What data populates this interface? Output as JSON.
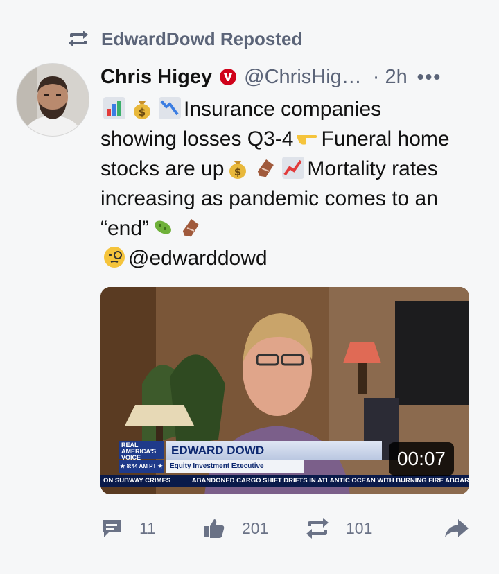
{
  "repost": {
    "label": "EdwardDowd Reposted",
    "icon": "repost-icon"
  },
  "post": {
    "author_name": "Chris Higey",
    "handle": "@ChrisHig…",
    "separator": "·",
    "time": "2h",
    "more": "•••",
    "text": {
      "seg1": "Insurance companies showing losses Q3-4",
      "seg2": "Funeral home stocks are up",
      "seg3": "Mortality rates increasing as pandemic comes to an “end”",
      "seg4": "@edwarddowd"
    },
    "emojis": [
      "bar-chart",
      "money-bag",
      "chart-decreasing",
      "pointing-right",
      "money-bag",
      "coffin",
      "chart-increasing",
      "microbe",
      "coffin",
      "face-with-monocle"
    ]
  },
  "video": {
    "brand_line1": "REAL",
    "brand_line2": "AMERICA'S",
    "brand_line3": "VOICE",
    "clock": "★ 8:44 AM PT ★",
    "guest_name": "EDWARD DOWD",
    "guest_title": "Equity Investment Executive",
    "ticker": [
      "ON SUBWAY CRIMES",
      "ABANDONED CARGO SHIFT DRIFTS IN ATLANTIC OCEAN WITH BURNING FIRE ABOAR"
    ],
    "duration": "00:07"
  },
  "actions": {
    "comments": "11",
    "likes": "201",
    "reposts": "101"
  },
  "colors": {
    "muted": "#5b6478",
    "verified_red": "#d0021b",
    "tv_blue": "#1f3a8a"
  }
}
